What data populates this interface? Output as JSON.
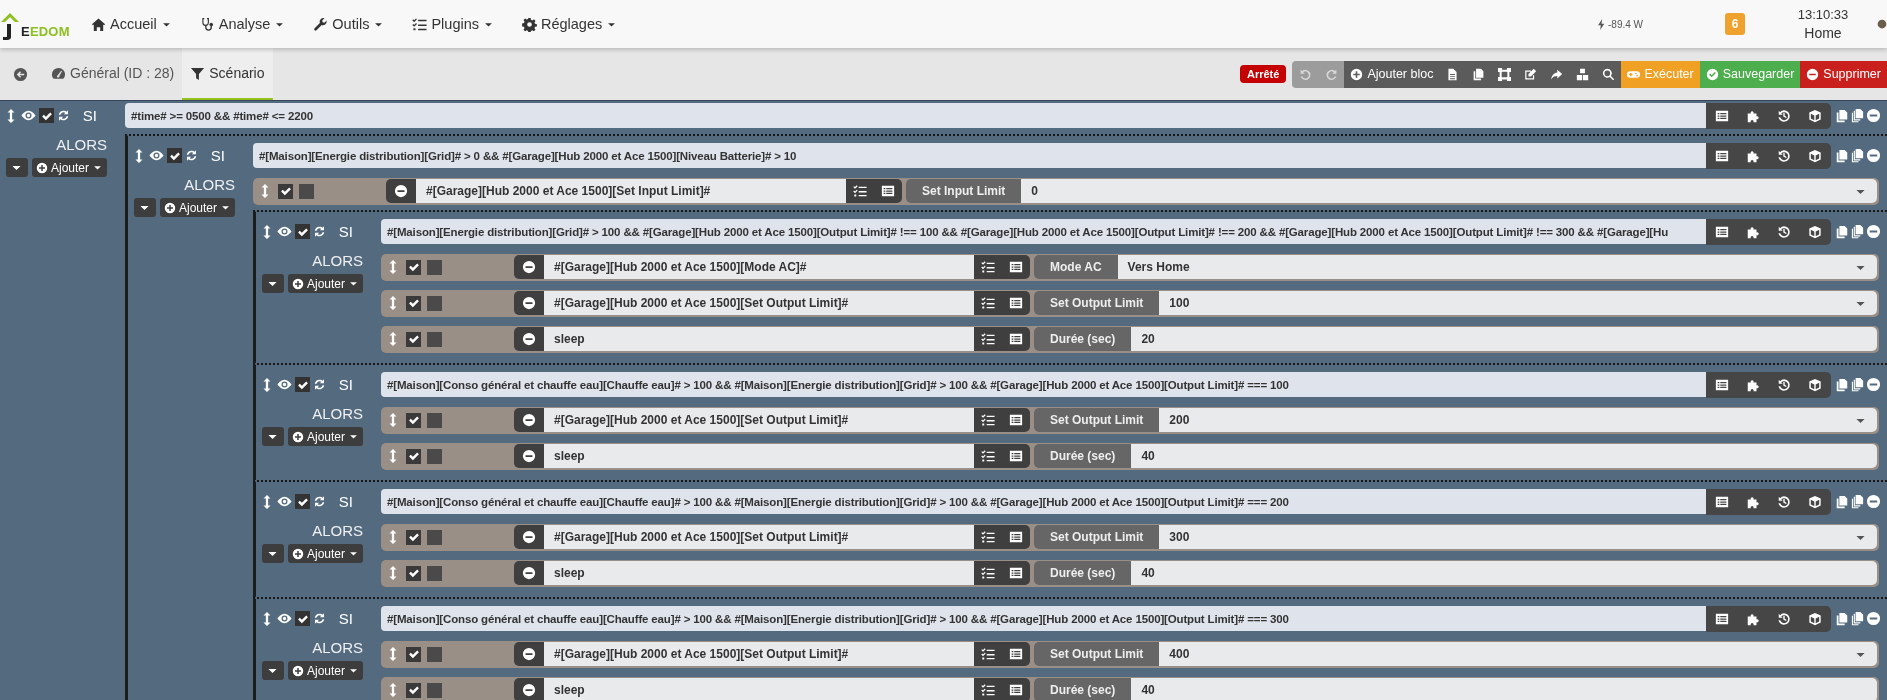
{
  "navbar": {
    "logo": "EEDOM",
    "menus": [
      {
        "kind": "home",
        "label": "Accueil"
      },
      {
        "kind": "analysis",
        "label": "Analyse"
      },
      {
        "kind": "tools",
        "label": "Outils"
      },
      {
        "kind": "plugins",
        "label": "Plugins"
      },
      {
        "kind": "settings",
        "label": "Réglages"
      }
    ],
    "power": "-89.4 W",
    "notifications": "6",
    "time": "13:10:33",
    "mode": "Home"
  },
  "tabs": [
    {
      "kind": "general",
      "label": "Général (ID : 28)",
      "selected": false
    },
    {
      "kind": "scenario",
      "label": "Scénario",
      "selected": true
    }
  ],
  "toolbar": {
    "status": "Arrêté",
    "buttons": [
      {
        "kind": "undo",
        "disabled": true
      },
      {
        "kind": "redo",
        "disabled": true
      },
      {
        "kind": "add_block",
        "label": "Ajouter bloc",
        "disabled": false
      },
      {
        "kind": "log",
        "disabled": false
      },
      {
        "kind": "copy",
        "disabled": false
      },
      {
        "kind": "fullscreen",
        "disabled": false
      },
      {
        "kind": "edit",
        "disabled": false
      },
      {
        "kind": "export",
        "disabled": false
      },
      {
        "kind": "dependencies",
        "disabled": false
      },
      {
        "kind": "search",
        "disabled": false
      },
      {
        "kind": "run",
        "label": "Exécuter",
        "disabled": false
      },
      {
        "kind": "save",
        "label": "Sauvegarder",
        "disabled": false
      },
      {
        "kind": "delete",
        "label": "Supprimer",
        "disabled": false
      }
    ]
  },
  "scenario": {
    "keyword": "SI",
    "enabled": true,
    "condition": "#time# >= 0500 && #time# <= 2200",
    "then_label": "ALORS",
    "add_label": "Ajouter",
    "children": [
      {
        "kind": "block",
        "keyword": "SI",
        "enabled": true,
        "condition": "#[Maison][Energie distribution][Grid]# > 0 && #[Garage][Hub 2000 et Ace 1500][Niveau Batterie]# > 10",
        "then_label": "ALORS",
        "add_label": "Ajouter",
        "children": [
          {
            "kind": "action",
            "enabled": true,
            "background": false,
            "expression": "#[Garage][Hub 2000 et Ace 1500][Set Input Limit]#",
            "option": "Set Input Limit",
            "value": "0",
            "dropdown": true
          },
          {
            "kind": "block",
            "keyword": "SI",
            "enabled": true,
            "condition": "#[Maison][Energie distribution][Grid]# > 100 && #[Garage][Hub 2000 et Ace 1500][Output Limit]# !== 100 && #[Garage][Hub 2000 et Ace 1500][Output Limit]# !== 200 && #[Garage][Hub 2000 et Ace 1500][Output Limit]# !== 300 && #[Garage][Hu",
            "then_label": "ALORS",
            "add_label": "Ajouter",
            "children": [
              {
                "kind": "action",
                "enabled": true,
                "background": false,
                "expression": "#[Garage][Hub 2000 et Ace 1500][Mode AC]#",
                "option": "Mode AC",
                "value": "Vers Home",
                "dropdown": true
              },
              {
                "kind": "action",
                "enabled": true,
                "background": false,
                "expression": "#[Garage][Hub 2000 et Ace 1500][Set Output Limit]#",
                "option": "Set Output Limit",
                "value": "100",
                "dropdown": true
              },
              {
                "kind": "action",
                "enabled": true,
                "background": false,
                "expression": "sleep",
                "option": "Durée (sec)",
                "value": "20",
                "dropdown": false
              }
            ]
          },
          {
            "kind": "block",
            "keyword": "SI",
            "enabled": true,
            "condition": "#[Maison][Conso général et chauffe eau][Chauffe eau]# > 100 && #[Maison][Energie distribution][Grid]# > 100 && #[Garage][Hub 2000 et Ace 1500][Output Limit]# === 100",
            "then_label": "ALORS",
            "add_label": "Ajouter",
            "children": [
              {
                "kind": "action",
                "enabled": true,
                "background": false,
                "expression": "#[Garage][Hub 2000 et Ace 1500][Set Output Limit]#",
                "option": "Set Output Limit",
                "value": "200",
                "dropdown": true
              },
              {
                "kind": "action",
                "enabled": true,
                "background": false,
                "expression": "sleep",
                "option": "Durée (sec)",
                "value": "40",
                "dropdown": false
              }
            ]
          },
          {
            "kind": "block",
            "keyword": "SI",
            "enabled": true,
            "condition": "#[Maison][Conso général et chauffe eau][Chauffe eau]# > 100 && #[Maison][Energie distribution][Grid]# > 100 && #[Garage][Hub 2000 et Ace 1500][Output Limit]# === 200",
            "then_label": "ALORS",
            "add_label": "Ajouter",
            "children": [
              {
                "kind": "action",
                "enabled": true,
                "background": false,
                "expression": "#[Garage][Hub 2000 et Ace 1500][Set Output Limit]#",
                "option": "Set Output Limit",
                "value": "300",
                "dropdown": true
              },
              {
                "kind": "action",
                "enabled": true,
                "background": false,
                "expression": "sleep",
                "option": "Durée (sec)",
                "value": "40",
                "dropdown": false
              }
            ]
          },
          {
            "kind": "block",
            "keyword": "SI",
            "enabled": true,
            "condition": "#[Maison][Conso général et chauffe eau][Chauffe eau]# > 100 && #[Maison][Energie distribution][Grid]# > 100 && #[Garage][Hub 2000 et Ace 1500][Output Limit]# === 300",
            "then_label": "ALORS",
            "add_label": "Ajouter",
            "children": [
              {
                "kind": "action",
                "enabled": true,
                "background": false,
                "expression": "#[Garage][Hub 2000 et Ace 1500][Set Output Limit]#",
                "option": "Set Output Limit",
                "value": "400",
                "dropdown": true
              },
              {
                "kind": "action",
                "enabled": true,
                "background": false,
                "expression": "sleep",
                "option": "Durée (sec)",
                "value": "40",
                "dropdown": false
              }
            ]
          }
        ]
      }
    ]
  }
}
